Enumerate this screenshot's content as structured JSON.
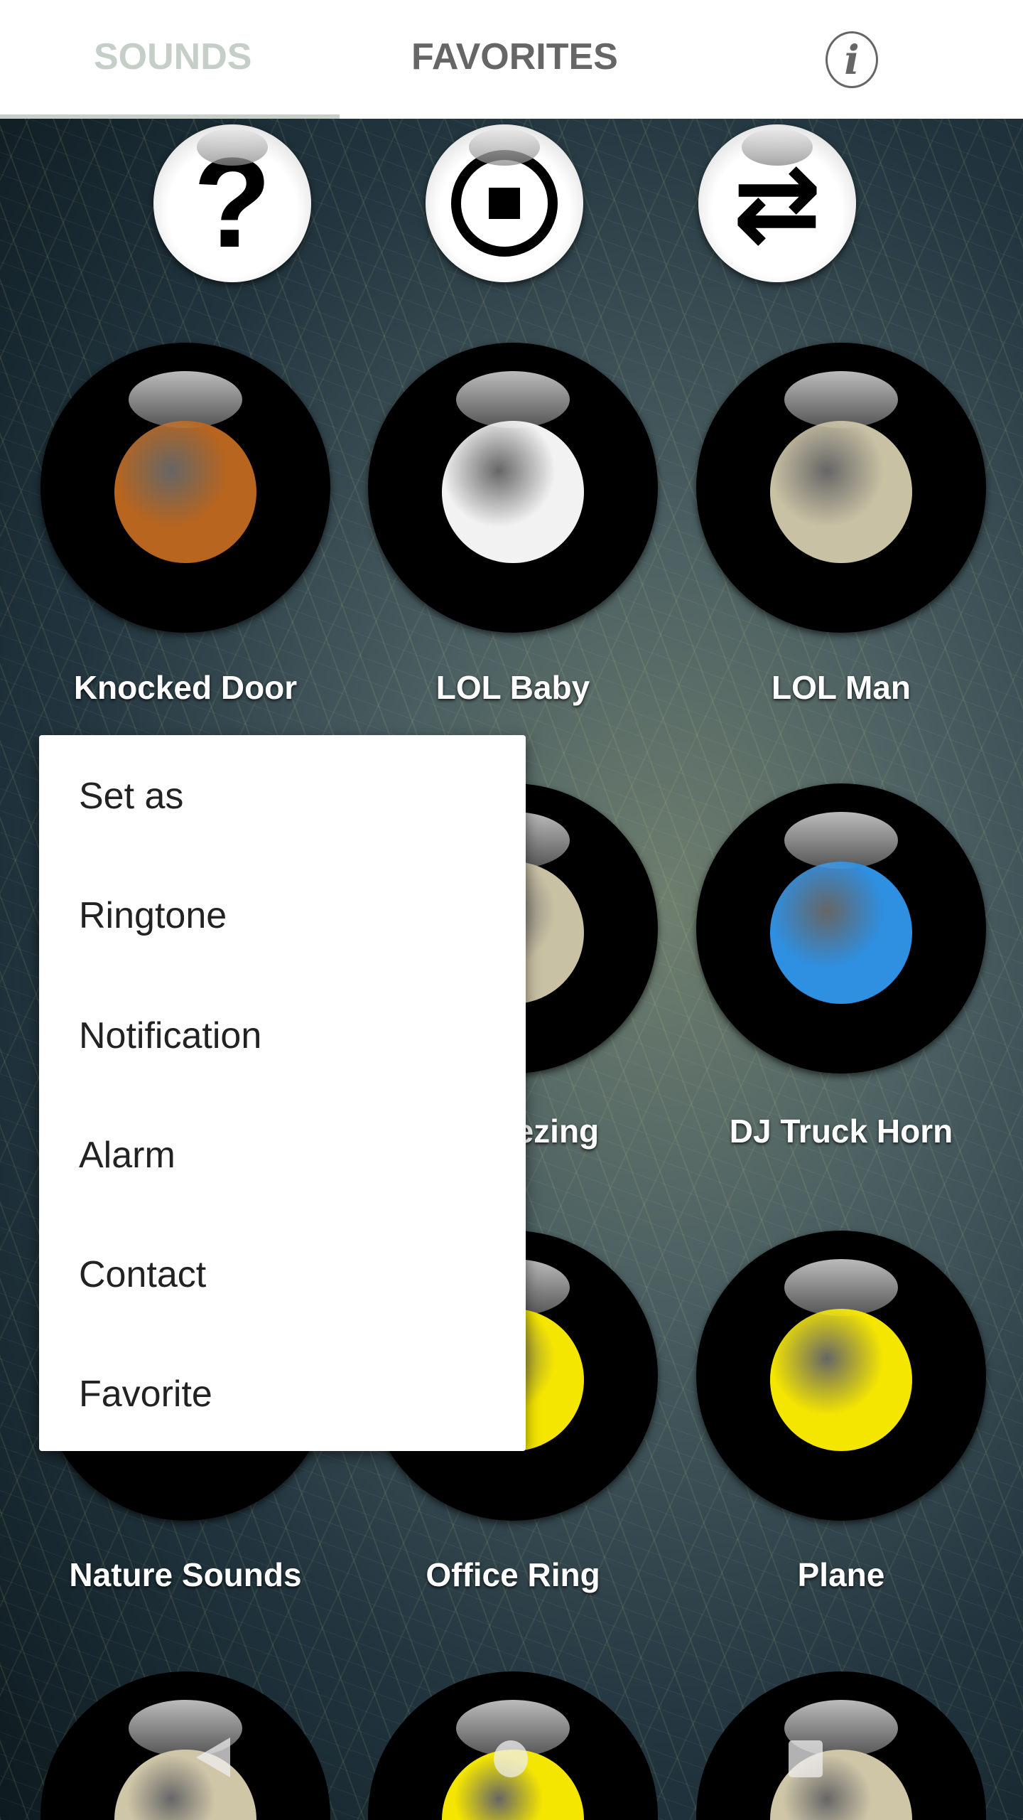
{
  "tabs": {
    "sounds": "SOUNDS",
    "favorites": "FAVORITES",
    "info_icon": "info-icon",
    "active": "SOUNDS"
  },
  "controls": [
    {
      "icon": "help-icon",
      "glyph": "?"
    },
    {
      "icon": "stop-icon"
    },
    {
      "icon": "repeat-icon",
      "glyph": "⇄"
    }
  ],
  "sounds": [
    {
      "label": "Knocked Door",
      "color": "#b8651f"
    },
    {
      "label": "LOL Baby",
      "color": "#f2f2f2"
    },
    {
      "label": "LOL Man",
      "color": "#c9c1a4"
    },
    {
      "label": "",
      "color": "#c9c1a4"
    },
    {
      "label": "eezing",
      "color": "#c9c1a4"
    },
    {
      "label": "DJ Truck Horn",
      "color": "#2f8fe0"
    },
    {
      "label": "Nature Sounds",
      "color": "#444"
    },
    {
      "label": "Office Ring",
      "color": "#f5e600"
    },
    {
      "label": "Plane",
      "color": "#f5e600"
    },
    {
      "label": "",
      "color": "#cfc6a8"
    },
    {
      "label": "",
      "color": "#f5e600"
    },
    {
      "label": "",
      "color": "#cfc6a8"
    }
  ],
  "menu": {
    "items": [
      "Set as",
      "Ringtone",
      "Notification",
      "Alarm",
      "Contact",
      "Favorite"
    ]
  },
  "navbar": {
    "back": "back-icon",
    "home": "home-icon",
    "recents": "recents-icon"
  }
}
